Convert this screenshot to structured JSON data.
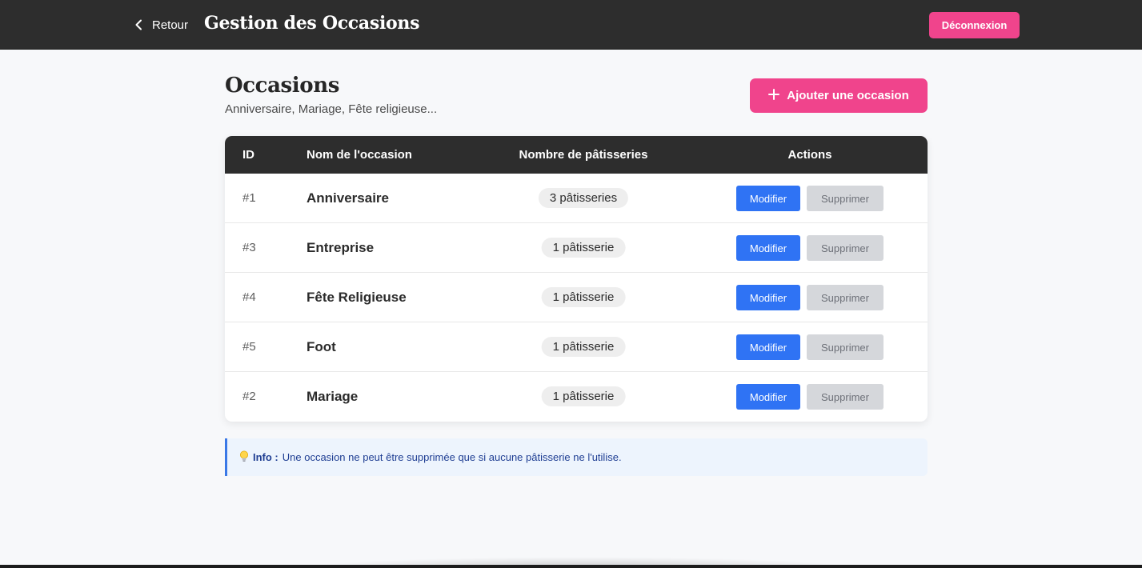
{
  "topbar": {
    "back_label": "Retour",
    "title": "Gestion des Occasions",
    "logout_label": "Déconnexion"
  },
  "page": {
    "heading": "Occasions",
    "subtitle": "Anniversaire, Mariage, Fête religieuse...",
    "add_button_label": "Ajouter une occasion"
  },
  "table": {
    "headers": {
      "id": "ID",
      "name": "Nom de l'occasion",
      "count": "Nombre de pâtisseries",
      "actions": "Actions"
    },
    "rows": [
      {
        "id": "#1",
        "name": "Anniversaire",
        "count": "3 pâtisseries",
        "edit": "Modifier",
        "delete": "Supprimer"
      },
      {
        "id": "#3",
        "name": "Entreprise",
        "count": "1 pâtisserie",
        "edit": "Modifier",
        "delete": "Supprimer"
      },
      {
        "id": "#4",
        "name": "Fête Religieuse",
        "count": "1 pâtisserie",
        "edit": "Modifier",
        "delete": "Supprimer"
      },
      {
        "id": "#5",
        "name": "Foot",
        "count": "1 pâtisserie",
        "edit": "Modifier",
        "delete": "Supprimer"
      },
      {
        "id": "#2",
        "name": "Mariage",
        "count": "1 pâtisserie",
        "edit": "Modifier",
        "delete": "Supprimer"
      }
    ]
  },
  "info": {
    "icon": "lightbulb-icon",
    "label": "Info :",
    "text": "Une occasion ne peut être supprimée que si aucune pâtisserie ne l'utilise."
  },
  "colors": {
    "topbar": "#2d2d2d",
    "accent_pink": "#f0448c",
    "edit_blue": "#2f73f4",
    "delete_disabled": "#d5d7db",
    "info_bg": "#edf4fd",
    "info_border": "#3a78e6"
  }
}
